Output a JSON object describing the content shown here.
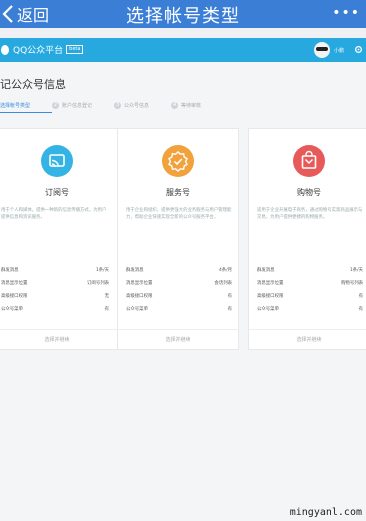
{
  "topbar": {
    "back_label": "返回",
    "title": "选择帐号类型",
    "more": "•••"
  },
  "qqbar": {
    "logo_text": "QQ公众平台",
    "logo_tag": "beta",
    "username": "小鹏"
  },
  "page": {
    "title": "记公众号信息",
    "steps": [
      {
        "num": "1",
        "label": "选择帐号类型"
      },
      {
        "num": "2",
        "label": "账户信息登记"
      },
      {
        "num": "3",
        "label": "公众号信息"
      },
      {
        "num": "4",
        "label": "等待审核"
      }
    ]
  },
  "cards": [
    {
      "name": "订阅号",
      "color": "#34b4e4",
      "icon": "rss-icon",
      "desc": "用于个人和媒体，提供一种新的信息传播方式，为用户提供信息和资讯服务。",
      "rows": [
        {
          "label": "群发消息",
          "value": "1条/天"
        },
        {
          "label": "消息显示位置",
          "value": "订阅号列表"
        },
        {
          "label": "高级接口权限",
          "value": "无"
        },
        {
          "label": "公众号菜单",
          "value": "有"
        }
      ],
      "footer": "选择并继续"
    },
    {
      "name": "服务号",
      "color": "#f1a23d",
      "icon": "badge-check-icon",
      "desc": "用于企业和组织，提供更强大的业务服务与用户管理能力，帮助企业快速实现全新的公众号服务平台。",
      "rows": [
        {
          "label": "群发消息",
          "value": "4条/月"
        },
        {
          "label": "消息显示位置",
          "value": "会话列表"
        },
        {
          "label": "高级接口权限",
          "value": "有"
        },
        {
          "label": "公众号菜单",
          "value": "有"
        }
      ],
      "footer": "选择并继续"
    },
    {
      "name": "购物号",
      "color": "#e85a5a",
      "icon": "shopping-bag-icon",
      "desc": "适用于企业开展电子商务，通过购物号实现商品展示与交易，为用户提供便捷的购物服务。",
      "rows": [
        {
          "label": "群发消息",
          "value": "1条/天"
        },
        {
          "label": "消息显示位置",
          "value": "购物号列表"
        },
        {
          "label": "高级接口权限",
          "value": "有"
        },
        {
          "label": "公众号菜单",
          "value": "有"
        }
      ],
      "footer": "选择并继续"
    }
  ],
  "watermark": "mingyanl.com"
}
